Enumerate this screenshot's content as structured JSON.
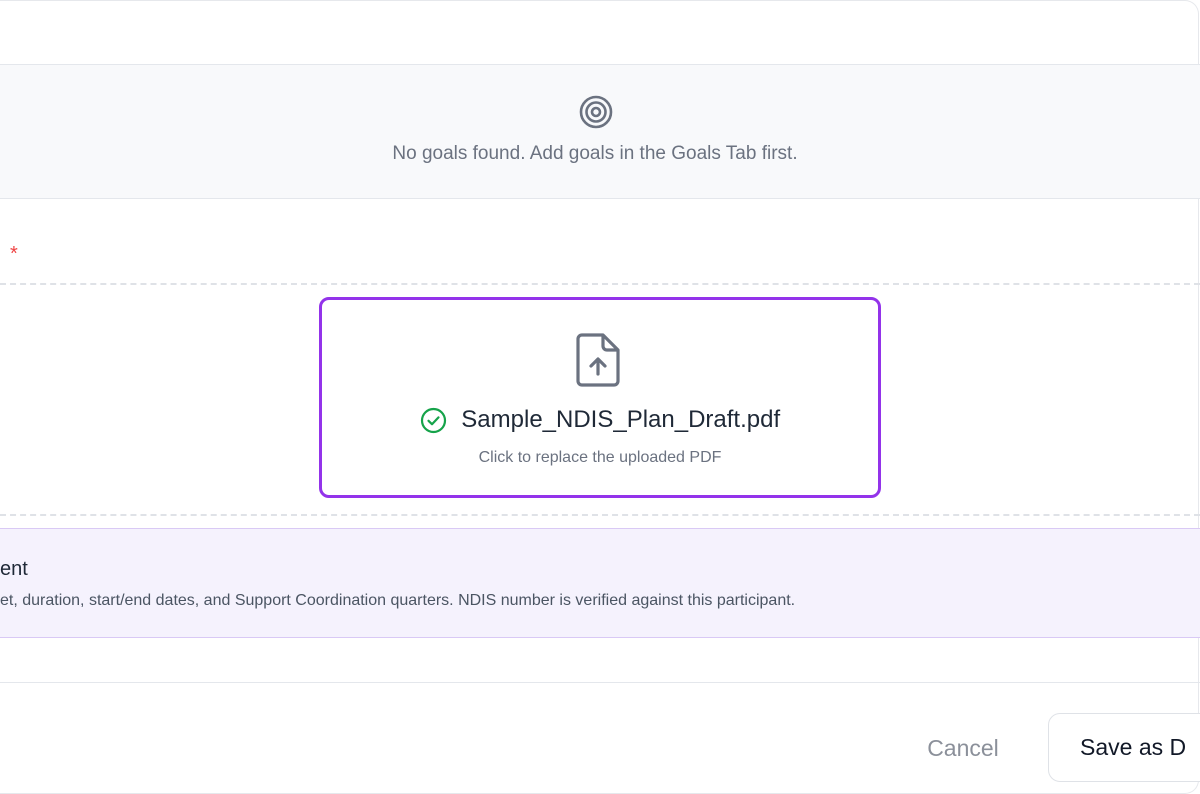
{
  "goals": {
    "icon": "target-icon",
    "empty_message": "No goals found. Add goals in the Goals Tab first."
  },
  "upload": {
    "required_marker": "*",
    "file_icon": "file-upload-icon",
    "status_icon": "check-circle-icon",
    "file_name": "Sample_NDIS_Plan_Draft.pdf",
    "hint": "Click to replace the uploaded PDF"
  },
  "info_panel": {
    "title": "ent",
    "description": "et, duration, start/end dates, and Support Coordination quarters. NDIS number is verified against this participant."
  },
  "footer": {
    "cancel_label": "Cancel",
    "save_draft_label": "Save as D"
  },
  "colors": {
    "accent": "#9333ea",
    "success": "#16a34a",
    "required": "#ef4444",
    "info_bg": "#f5f2fd",
    "muted_text": "#6b7280"
  }
}
